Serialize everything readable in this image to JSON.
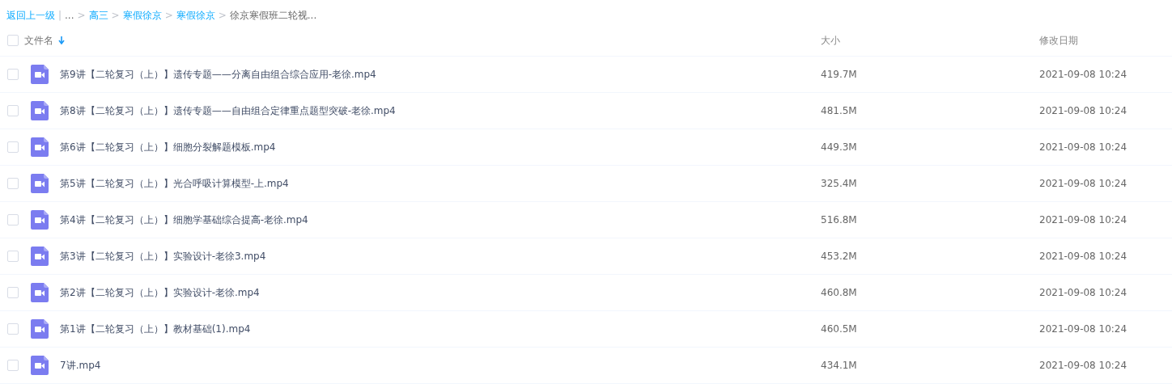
{
  "breadcrumb": [
    {
      "kind": "link",
      "text": "返回上一级"
    },
    {
      "kind": "divider",
      "text": "|"
    },
    {
      "kind": "text",
      "text": "..."
    },
    {
      "kind": "separator",
      "text": ">"
    },
    {
      "kind": "link",
      "text": "高三"
    },
    {
      "kind": "separator",
      "text": ">"
    },
    {
      "kind": "link",
      "text": "寒假徐京"
    },
    {
      "kind": "separator",
      "text": ">"
    },
    {
      "kind": "link",
      "text": "寒假徐京"
    },
    {
      "kind": "separator",
      "text": ">"
    },
    {
      "kind": "current",
      "text": "徐京寒假班二轮视..."
    }
  ],
  "table": {
    "select_all": {
      "checked": false
    },
    "columns": [
      {
        "label": "文件名",
        "sorted": true
      },
      {
        "label": "大小",
        "sorted": false
      },
      {
        "label": "修改日期",
        "sorted": false
      }
    ],
    "rows": [
      {
        "checked": false,
        "name": "第9讲【二轮复习（上）】遗传专题——分离自由组合综合应用-老徐.mp4",
        "size": "419.7M",
        "modified": "2021-09-08 10:24"
      },
      {
        "checked": false,
        "name": "第8讲【二轮复习（上）】遗传专题——自由组合定律重点题型突破-老徐.mp4",
        "size": "481.5M",
        "modified": "2021-09-08 10:24"
      },
      {
        "checked": false,
        "name": "第6讲【二轮复习（上）】细胞分裂解题模板.mp4",
        "size": "449.3M",
        "modified": "2021-09-08 10:24"
      },
      {
        "checked": false,
        "name": "第5讲【二轮复习（上）】光合呼吸计算模型-上.mp4",
        "size": "325.4M",
        "modified": "2021-09-08 10:24"
      },
      {
        "checked": false,
        "name": "第4讲【二轮复习（上）】细胞学基础综合提高-老徐.mp4",
        "size": "516.8M",
        "modified": "2021-09-08 10:24"
      },
      {
        "checked": false,
        "name": "第3讲【二轮复习（上）】实验设计-老徐3.mp4",
        "size": "453.2M",
        "modified": "2021-09-08 10:24"
      },
      {
        "checked": false,
        "name": "第2讲【二轮复习（上）】实验设计-老徐.mp4",
        "size": "460.8M",
        "modified": "2021-09-08 10:24"
      },
      {
        "checked": false,
        "name": "第1讲【二轮复习（上）】教材基础(1).mp4",
        "size": "460.5M",
        "modified": "2021-09-08 10:24"
      },
      {
        "checked": false,
        "name": "7讲.mp4",
        "size": "434.1M",
        "modified": "2021-09-08 10:24"
      }
    ]
  }
}
